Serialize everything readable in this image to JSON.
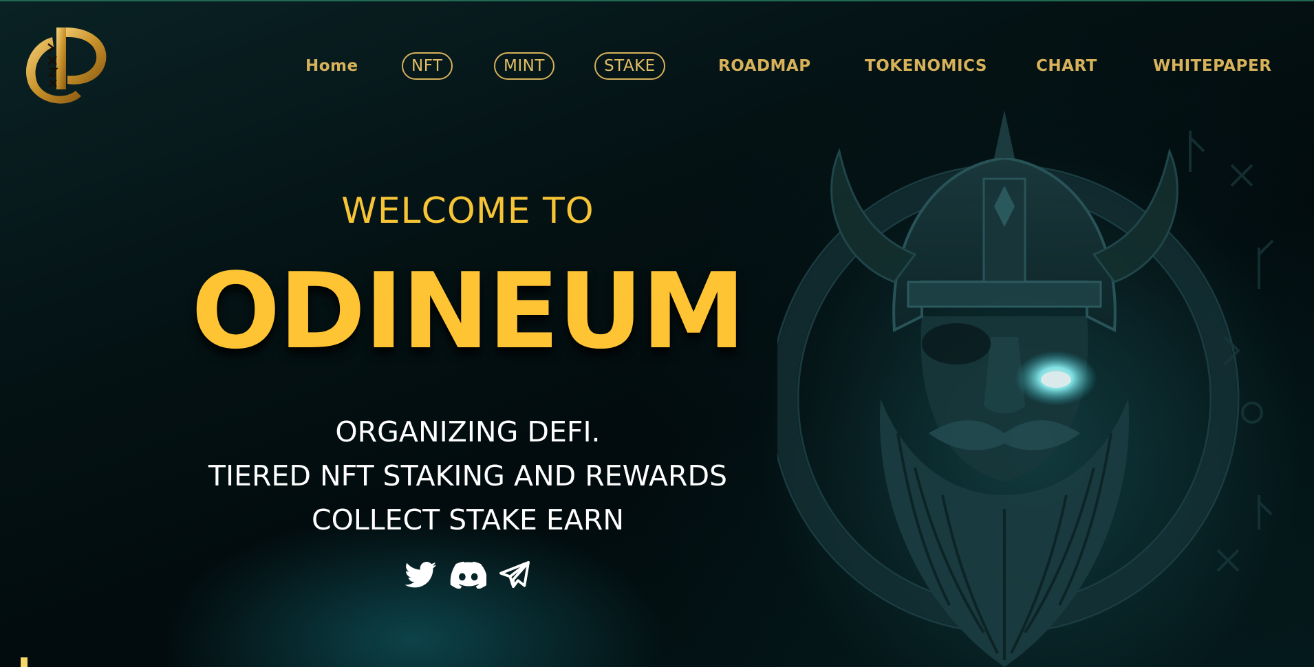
{
  "brand": {
    "logo_icon": "odineum-logo-icon",
    "accent_color": "#ffc434",
    "nav_color": "#d8b25a"
  },
  "nav": {
    "items": [
      {
        "label": "Home",
        "style": "plain"
      },
      {
        "label": "NFT",
        "style": "pill"
      },
      {
        "label": "MINT",
        "style": "pill"
      },
      {
        "label": "STAKE",
        "style": "pill"
      },
      {
        "label": "ROADMAP",
        "style": "plain"
      },
      {
        "label": "TOKENOMICS",
        "style": "plain"
      },
      {
        "label": "CHART",
        "style": "plain"
      },
      {
        "label": "WHITEPAPER",
        "style": "plain"
      }
    ]
  },
  "hero": {
    "welcome": "WELCOME TO",
    "title": "ODINEUM",
    "lines": [
      "ORGANIZING DEFI.",
      "TIERED NFT STAKING AND REWARDS",
      "COLLECT STAKE EARN"
    ],
    "socials": [
      {
        "icon": "twitter-icon"
      },
      {
        "icon": "discord-icon"
      },
      {
        "icon": "telegram-icon"
      }
    ]
  },
  "art": {
    "icon": "odin-viking-illustration"
  }
}
